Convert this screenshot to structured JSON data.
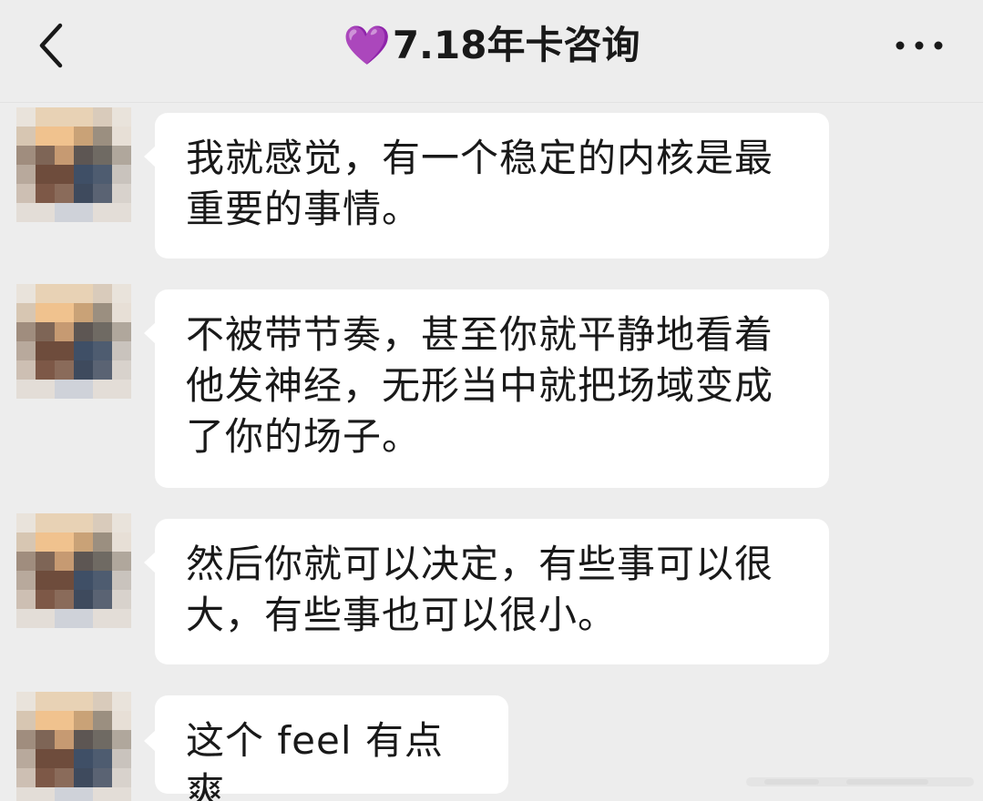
{
  "header": {
    "heart_icon": "💜",
    "title": "7.18年卡咨询",
    "back_icon": "chevron-left-icon",
    "more_icon": "more-horizontal-icon"
  },
  "messages": [
    {
      "text": "我就感觉，有一个稳定的内核是最\n重要的事情。"
    },
    {
      "text": "不被带节奏，甚至你就平静地看着\n他发神经，无形当中就把场域变成\n了你的场子。"
    },
    {
      "text": "然后你就可以决定，有些事可以很\n大，有些事也可以很小。"
    },
    {
      "text": "这个 feel 有点爽"
    }
  ],
  "colors": {
    "background": "#ededed",
    "bubble": "#ffffff",
    "text": "#191919",
    "heart": "#a24de0"
  }
}
